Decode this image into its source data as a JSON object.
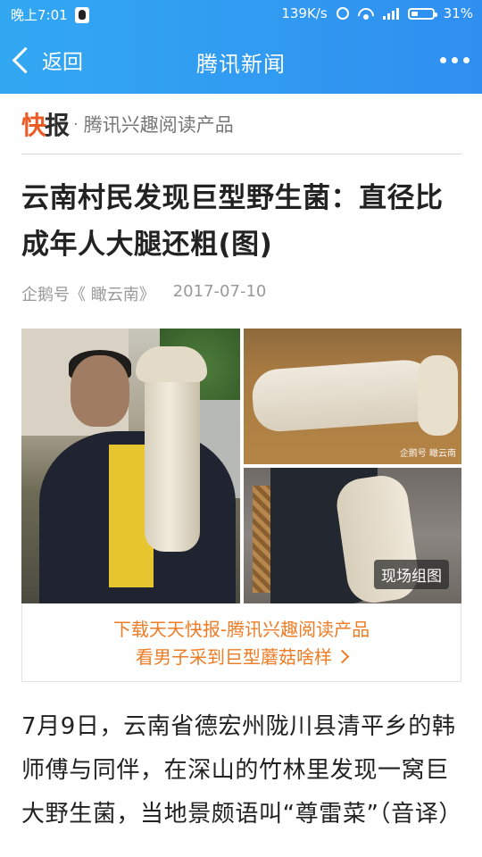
{
  "status_bar": {
    "time": "晚上7:01",
    "speed": "139K/s",
    "battery": "31%"
  },
  "nav": {
    "back_label": "返回",
    "title": "腾讯新闻"
  },
  "source": {
    "logo_k": "快",
    "logo_b": "报",
    "separator": "·",
    "text": "腾讯兴趣阅读产品"
  },
  "article": {
    "title": "云南村民发现巨型野生菌：直径比成年人大腿还粗(图)",
    "author": "企鹅号《 瞰云南》",
    "date": "2017-07-10",
    "gallery_watermark": "企鹅号 瞰云南",
    "gallery_tag": "现场组图",
    "promo_line1": "下载天天快报-腾讯兴趣阅读产品",
    "promo_line2": "看男子采到巨型蘑菇啥样",
    "body": "7月9日，云南省德宏州陇川县清平乡的韩师傅与同伴，在深山的竹林里发现一窝巨大野生菌，当地景颇语叫“尊雷菜”（音译）"
  },
  "colors": {
    "nav_blue": "#2f8ff0",
    "brand_orange": "#ee5a24",
    "promo_orange": "#ee7c24"
  },
  "icons": [
    "qq-icon",
    "alarm-icon",
    "wifi-icon",
    "signal-icon",
    "battery-icon",
    "back-chevron-icon",
    "more-icon",
    "chevron-right-icon"
  ]
}
